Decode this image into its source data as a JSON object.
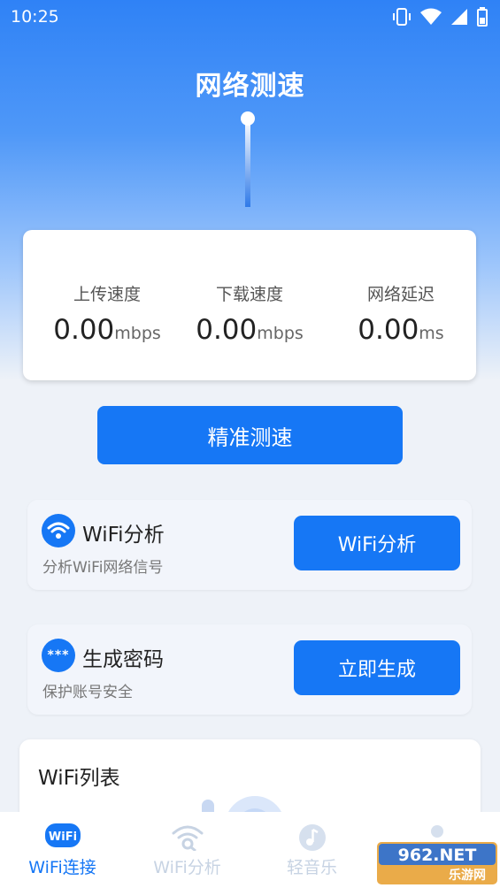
{
  "status_bar": {
    "time": "10:25"
  },
  "header": {
    "title": "网络测速"
  },
  "metrics": [
    {
      "label": "上传速度",
      "value": "0.00",
      "unit": "mbps"
    },
    {
      "label": "下载速度",
      "value": "0.00",
      "unit": "mbps"
    },
    {
      "label": "网络延迟",
      "value": "0.00",
      "unit": "ms"
    }
  ],
  "primary_button": "精准测速",
  "features": [
    {
      "name": "WiFi分析",
      "description": "分析WiFi网络信号",
      "button": "WiFi分析",
      "icon": "wifi-icon"
    },
    {
      "name": "生成密码",
      "description": "保护账号安全",
      "button": "立即生成",
      "icon": "password-icon"
    }
  ],
  "wifi_list": {
    "title": "WiFi列表"
  },
  "tabs": [
    {
      "label": "WiFi连接",
      "icon": "wifi-badge-icon",
      "active": true
    },
    {
      "label": "WiFi分析",
      "icon": "wifi-search-icon",
      "active": false
    },
    {
      "label": "轻音乐",
      "icon": "music-note-icon",
      "active": false
    },
    {
      "label": "",
      "icon": "profile-icon",
      "active": false
    }
  ],
  "watermark": {
    "text": "962.NET",
    "subtext": "乐游网"
  },
  "colors": {
    "accent": "#1677f5",
    "hero_top": "#2f82f6"
  }
}
